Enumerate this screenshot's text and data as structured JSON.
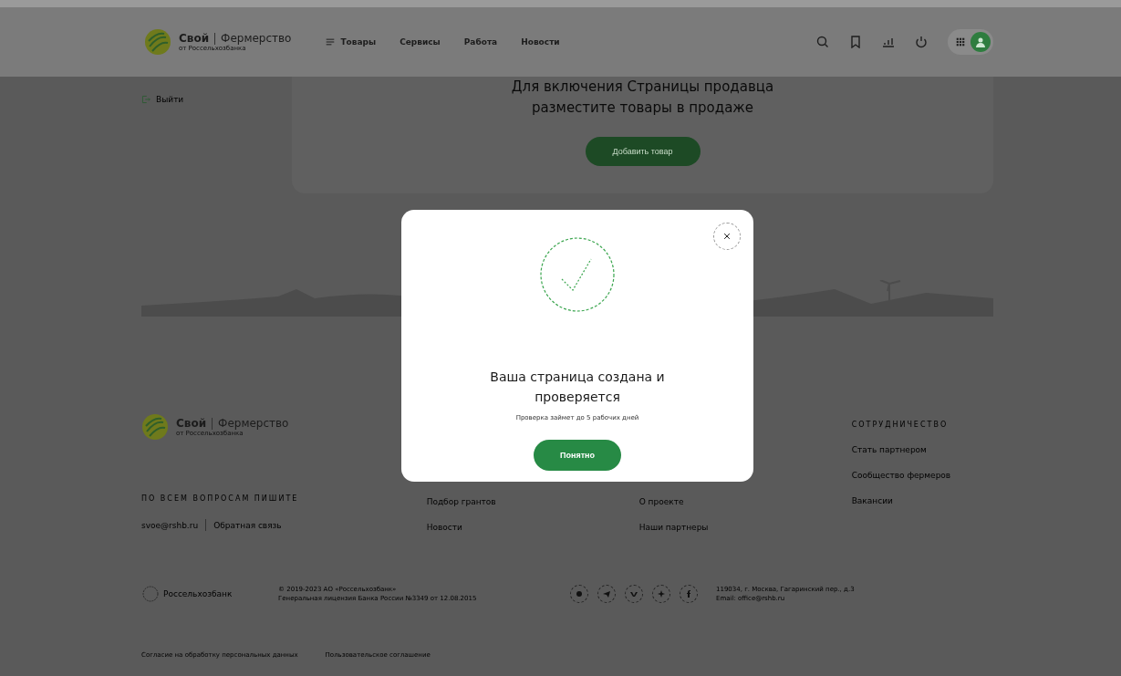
{
  "header": {
    "logo": {
      "brand": "Свой",
      "product": "Фермерство",
      "subtitle": "от Россельхозбанка"
    },
    "nav": [
      {
        "label": "Товары",
        "kind": "menu"
      },
      {
        "label": "Сервисы",
        "kind": "link"
      },
      {
        "label": "Работа",
        "kind": "link"
      },
      {
        "label": "Новости",
        "kind": "link"
      }
    ]
  },
  "sidebar": {
    "logout": "Выйти"
  },
  "banner": {
    "message": "Для включения Страницы продавца разместите товары в продаже",
    "button": "Добавить товар"
  },
  "modal": {
    "title": "Ваша страница создана и проверяется",
    "note": "Проверка займет до 5 рабочих дней",
    "button": "Понятно"
  },
  "footer": {
    "logo": {
      "brand": "Свой",
      "product": "Фермерство",
      "subtitle": "от Россельхозбанка"
    },
    "contact_heading": "ПО ВСЕМ ВОПРОСАМ ПИШИТЕ",
    "email": "svoe@rshb.ru",
    "feedback": "Обратная связь",
    "columns": [
      {
        "links": [
          "Подбор грантов",
          "Новости"
        ]
      },
      {
        "links": [
          "О проекте",
          "Наши партнеры"
        ]
      },
      {
        "heading": "СОТРУДНИЧЕСТВО",
        "links": [
          "Стать партнером",
          "Сообщество фермеров",
          "Вакансии"
        ]
      }
    ],
    "bank": "Россельхозбанк",
    "legal": [
      "© 2019-2023 АО «Россельхозбанк»",
      "Генеральная лицензия Банка России №3349 от 12.08.2015"
    ],
    "address": [
      "119034, г. Москва, Гагаринский пер., д.3",
      "Email: office@rshb.ru"
    ],
    "bottom_links": [
      "Согласие на обработку персональных данных",
      "Пользовательское соглашение"
    ]
  }
}
